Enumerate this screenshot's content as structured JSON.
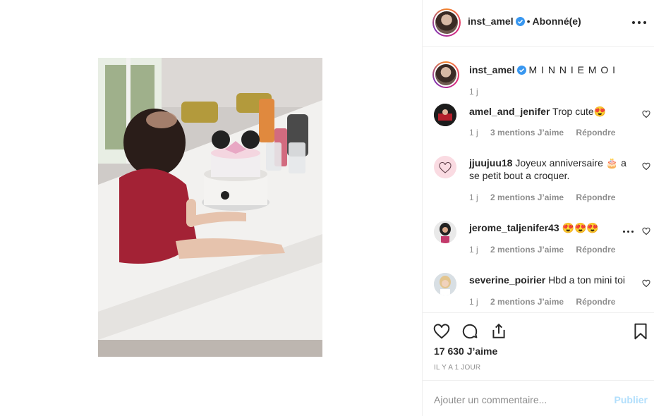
{
  "header": {
    "username": "inst_amel",
    "separator": "•",
    "follow_label": "Abonné(e)"
  },
  "caption": {
    "username": "inst_amel",
    "text": "M I N N I E M O I",
    "age": "1 j"
  },
  "comments": [
    {
      "username": "amel_and_jenifer",
      "text": "Trop cute😍",
      "age": "1 j",
      "likes": "3 mentions J’aime",
      "reply": "Répondre"
    },
    {
      "username": "jjuujuu18",
      "text": "Joyeux anniversaire 🎂 a se petit bout a croquer.",
      "age": "1 j",
      "likes": "2 mentions J’aime",
      "reply": "Répondre"
    },
    {
      "username": "jerome_taljenifer43",
      "text": "😍😍😍",
      "age": "1 j",
      "likes": "2 mentions J’aime",
      "reply": "Répondre"
    },
    {
      "username": "severine_poirier",
      "text": "Hbd a ton mini toi",
      "age": "1 j",
      "likes": "2 mentions J’aime",
      "reply": "Répondre"
    }
  ],
  "post": {
    "likes": "17 630 J’aime",
    "time": "IL Y A 1 JOUR"
  },
  "add_comment": {
    "placeholder": "Ajouter un commentaire...",
    "publish": "Publier"
  },
  "colors": {
    "verified": "#3897f0",
    "publish_disabled": "#b2dffc",
    "muted": "#8e8e8e"
  }
}
